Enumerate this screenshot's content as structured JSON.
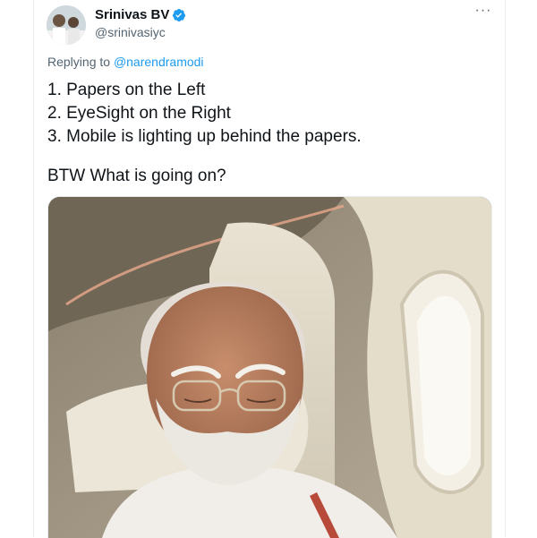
{
  "tweet": {
    "author": {
      "name": "Srinivas BV",
      "handle": "@srinivasiyc",
      "verified": true,
      "avatar_icon": "user-avatar"
    },
    "more_icon": "more-options-icon",
    "more_label": "···",
    "reply_prefix": "Replying to",
    "reply_to": "@narendramodi",
    "lines": [
      "1. Papers on the Left",
      "2. EyeSight on the Right",
      "3. Mobile is lighting up behind the papers."
    ],
    "closing": "BTW What is going on?",
    "media_icon": "tweet-photo",
    "colors": {
      "accent": "#1d9bf0",
      "secondary_text": "#536471",
      "primary_text": "#0f1419"
    }
  }
}
